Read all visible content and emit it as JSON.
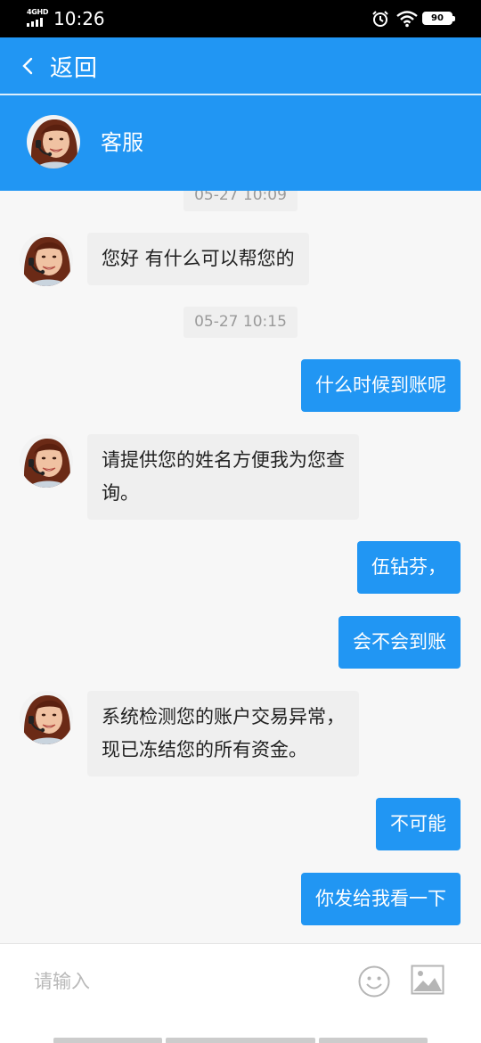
{
  "status_bar": {
    "network": "4GHD",
    "time": "10:26",
    "battery": "90",
    "icons": [
      "signal-icon",
      "alarm-icon",
      "wifi-icon",
      "battery-icon"
    ]
  },
  "header": {
    "back_label": "返回",
    "back_icon": "chevron-left-icon",
    "agent_name": "客服",
    "color": "#2196f3"
  },
  "messages": [
    {
      "type": "time",
      "text": "05-27 10:09"
    },
    {
      "type": "in",
      "lines": [
        "您好 有什么可以帮您的"
      ]
    },
    {
      "type": "time",
      "text": "05-27 10:15"
    },
    {
      "type": "out",
      "lines": [
        "什么时候到账呢"
      ]
    },
    {
      "type": "in",
      "lines": [
        "请提供您的姓名方便我为您查",
        "询。"
      ]
    },
    {
      "type": "out",
      "lines": [
        "伍钻芬，"
      ]
    },
    {
      "type": "out",
      "lines": [
        "会不会到账"
      ]
    },
    {
      "type": "in",
      "lines": [
        "系统检测您的账户交易异常，",
        "现已冻结您的所有资金。"
      ]
    },
    {
      "type": "out",
      "lines": [
        "不可能"
      ]
    },
    {
      "type": "out",
      "lines": [
        "你发给我看一下"
      ]
    }
  ],
  "input_bar": {
    "placeholder": "请输入",
    "icons": [
      "emoji-icon",
      "image-icon"
    ]
  }
}
